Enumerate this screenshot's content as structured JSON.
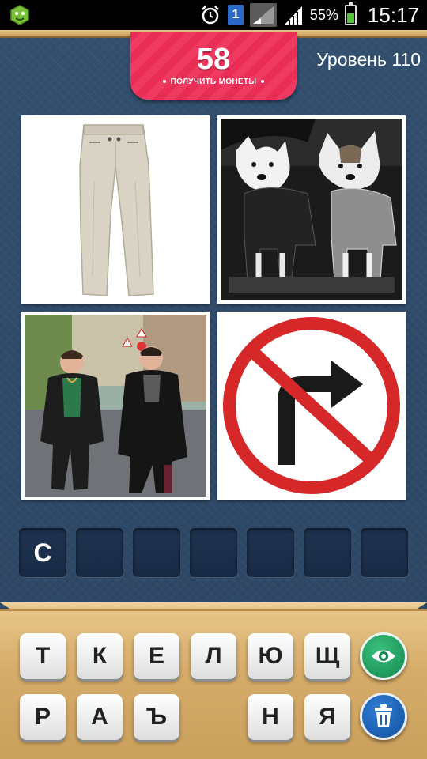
{
  "status_bar": {
    "battery_percent": "55%",
    "battery_level": 0.55,
    "time": "15:17",
    "sim_slot": "1",
    "icons": [
      "app-icon",
      "alarm-icon",
      "sim-icon",
      "signal-icon",
      "signal-icon",
      "battery-icon"
    ]
  },
  "header": {
    "coins": "58",
    "get_coins_label": "ПОЛУЧИТЬ МОНЕТЫ",
    "level_label": "Уровень 110"
  },
  "pictures": [
    {
      "icon": "trousers-picture"
    },
    {
      "icon": "space-dogs-picture"
    },
    {
      "icon": "gangsters-picture"
    },
    {
      "icon": "no-right-turn-sign-picture"
    }
  ],
  "answer_slots": [
    "С",
    "",
    "",
    "",
    "",
    "",
    ""
  ],
  "keyboard": {
    "row1": [
      "Т",
      "К",
      "Е",
      "Л",
      "Ю",
      "Щ"
    ],
    "row2": [
      "Р",
      "А",
      "Ъ",
      "",
      "Н",
      "Я"
    ]
  },
  "actions": {
    "reveal_icon": "eye-icon",
    "remove_icon": "trash-icon"
  },
  "colors": {
    "ribbon": "#ea2d55",
    "background": "#2f4766",
    "board": "#d6ac6a",
    "reveal_button": "#1fa563",
    "remove_button": "#1d62b7"
  }
}
